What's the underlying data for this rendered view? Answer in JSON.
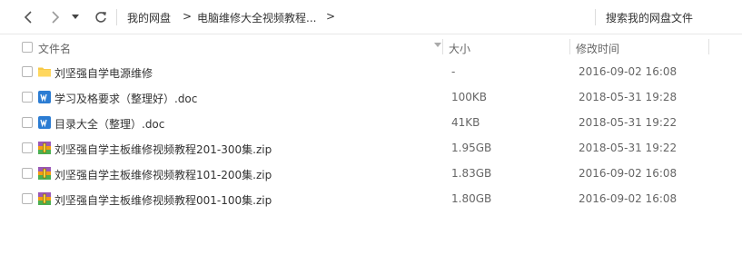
{
  "nav": {
    "back_icon": "chevron-left-icon",
    "forward_icon": "chevron-right-icon",
    "dropdown_icon": "caret-down-icon",
    "refresh_icon": "refresh-icon",
    "breadcrumb": [
      "我的网盘",
      "电脑维修大全视频教程..."
    ],
    "search_label": "搜索我的网盘文件"
  },
  "columns": {
    "name": "文件名",
    "size": "大小",
    "modified": "修改时间"
  },
  "files": [
    {
      "name": "刘坚强自学电源维修",
      "size": "-",
      "modified": "2016-09-02 16:08",
      "icon": "folder-icon"
    },
    {
      "name": "学习及格要求（整理好）.doc",
      "size": "100KB",
      "modified": "2018-05-31 19:28",
      "icon": "word-doc-icon"
    },
    {
      "name": "目录大全（整理）.doc",
      "size": "41KB",
      "modified": "2018-05-31 19:22",
      "icon": "word-doc-icon"
    },
    {
      "name": "刘坚强自学主板维修视频教程201-300集.zip",
      "size": "1.95GB",
      "modified": "2018-05-31 19:22",
      "icon": "zip-archive-icon"
    },
    {
      "name": "刘坚强自学主板维修视频教程101-200集.zip",
      "size": "1.83GB",
      "modified": "2016-09-02 16:08",
      "icon": "zip-archive-icon"
    },
    {
      "name": "刘坚强自学主板维修视频教程001-100集.zip",
      "size": "1.80GB",
      "modified": "2016-09-02 16:08",
      "icon": "zip-archive-icon"
    }
  ],
  "colors": {
    "folder": "#f7c948",
    "word": "#2b7cd3",
    "zip_purple": "#9b59b6",
    "zip_orange": "#f39c12",
    "zip_green": "#4caf50"
  }
}
